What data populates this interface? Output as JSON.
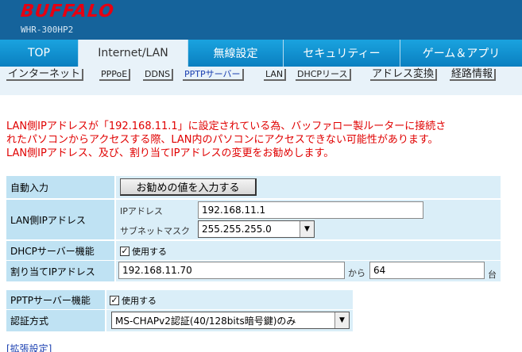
{
  "header": {
    "brand": "BUFFALO",
    "model": "WHR-300HP2"
  },
  "main_tabs": [
    {
      "label": "TOP"
    },
    {
      "label": "Internet/LAN"
    },
    {
      "label": "無線設定"
    },
    {
      "label": "セキュリティー"
    },
    {
      "label": "ゲーム＆アプリ"
    }
  ],
  "sub_tabs": [
    {
      "label": "インターネット"
    },
    {
      "label": "PPPoE"
    },
    {
      "label": "DDNS"
    },
    {
      "label": "PPTPサーバー"
    },
    {
      "label": "LAN"
    },
    {
      "label": "DHCPリース"
    },
    {
      "label": "アドレス変換"
    },
    {
      "label": "経路情報"
    }
  ],
  "warning": {
    "line1": "LAN側IPアドレスが「192.168.11.1」に設定されている為、バッファロー製ルーターに接続さ",
    "line2": "れたパソコンからアクセスする際、LAN内のパソコンにアクセスできない可能性があります。",
    "line3": "LAN側IPアドレス、及び、割り当てIPアドレスの変更をお勧めします。"
  },
  "form": {
    "auto_label": "自動入力",
    "auto_button": "お勧めの値を入力する",
    "lan_ip_label": "LAN側IPアドレス",
    "ip_sub_label": "IPアドレス",
    "ip_value": "192.168.11.1",
    "mask_sub_label": "サブネットマスク",
    "mask_value": "255.255.255.0",
    "dhcp_label": "DHCPサーバー機能",
    "dhcp_check": "使用する",
    "assign_label": "割り当てIPアドレス",
    "assign_start": "192.168.11.70",
    "assign_from": "から",
    "assign_count": "64",
    "assign_unit": "台",
    "pptp_label": "PPTPサーバー機能",
    "pptp_check": "使用する",
    "auth_label": "認証方式",
    "auth_value": "MS-CHAPv2認証(40/128bits暗号鍵)のみ"
  },
  "advanced_link": "[拡張設定]"
}
